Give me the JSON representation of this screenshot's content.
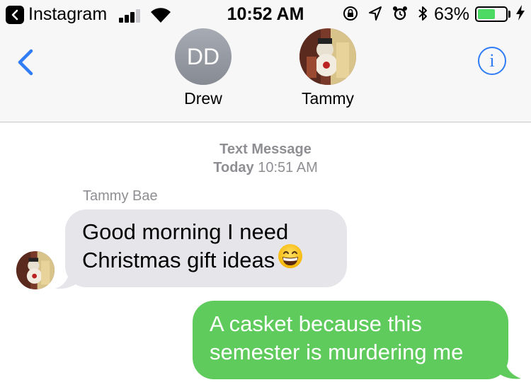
{
  "status_bar": {
    "back_app_label": "Instagram",
    "time": "10:52 AM",
    "battery_percent": "63%",
    "battery_level": 0.63,
    "signal_bars": 3,
    "icons": [
      "orientation-lock-icon",
      "location-icon",
      "alarm-icon",
      "bluetooth-icon",
      "charging-bolt-icon"
    ]
  },
  "header": {
    "contacts": [
      {
        "initials": "DD",
        "name": "Drew"
      },
      {
        "name": "Tammy",
        "avatar": "tammy-photo"
      }
    ],
    "info_label": "i"
  },
  "conversation": {
    "service_label": "Text Message",
    "day": "Today",
    "time": "10:51 AM",
    "messages": [
      {
        "direction": "incoming",
        "sender": "Tammy Bae",
        "lines": [
          "Good morning I need",
          "Christmas gift ideas"
        ],
        "emoji": "grinning-face-with-smiling-eyes"
      },
      {
        "direction": "outgoing",
        "lines": [
          "A casket because this",
          "semester is murdering me"
        ]
      }
    ]
  },
  "colors": {
    "accent": "#2f7cf6",
    "incoming_bubble": "#e5e5ea",
    "outgoing_bubble": "#5fcb5c",
    "battery_green": "#4cd964",
    "meta_text": "#8e8e93"
  }
}
